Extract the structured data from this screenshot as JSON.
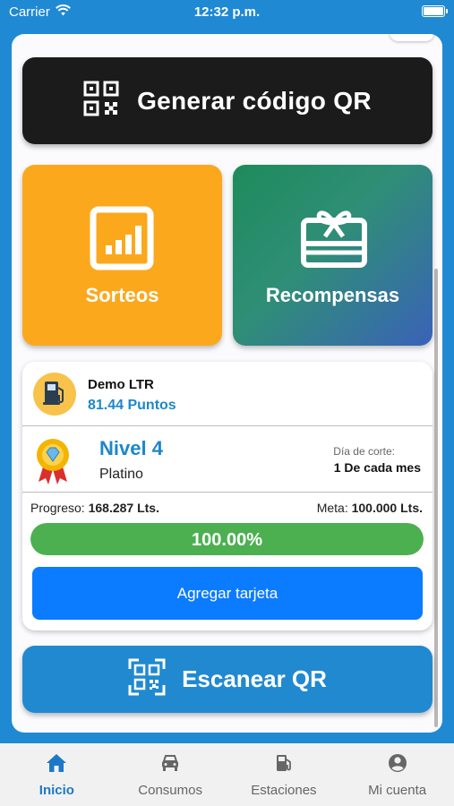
{
  "status_bar": {
    "carrier": "Carrier",
    "time": "12:32 p.m."
  },
  "actions": {
    "generate_qr_label": "Generar código QR",
    "scan_qr_label": "Escanear QR"
  },
  "tiles": [
    {
      "label": "Sorteos",
      "icon": "chart-icon",
      "color": "#fca81d"
    },
    {
      "label": "Recompensas",
      "icon": "gift-card-icon",
      "color": "#2f8e77"
    }
  ],
  "account": {
    "name": "Demo LTR",
    "points": "81.44 Puntos",
    "level_title": "Nivel 4",
    "level_name": "Platino",
    "cut_label": "Día de corte:",
    "cut_value": "1 De cada mes",
    "progress_label": "Progreso:",
    "progress_value": "168.287 Lts.",
    "goal_label": "Meta:",
    "goal_value": "100.000 Lts.",
    "progress_percent_text": "100.00%",
    "progress_fraction": 1.0,
    "add_card_label": "Agregar tarjeta"
  },
  "tabbar": {
    "items": [
      {
        "label": "Inicio",
        "icon": "home-icon",
        "active": true
      },
      {
        "label": "Consumos",
        "icon": "car-icon",
        "active": false
      },
      {
        "label": "Estaciones",
        "icon": "fuel-pump-icon",
        "active": false
      },
      {
        "label": "Mi cuenta",
        "icon": "account-icon",
        "active": false
      }
    ]
  },
  "colors": {
    "brand_blue": "#1e87c8",
    "background": "#1f89d3",
    "progress_green": "#4cb050",
    "button_blue": "#0b7bff",
    "sorteos_orange": "#fca81d"
  }
}
